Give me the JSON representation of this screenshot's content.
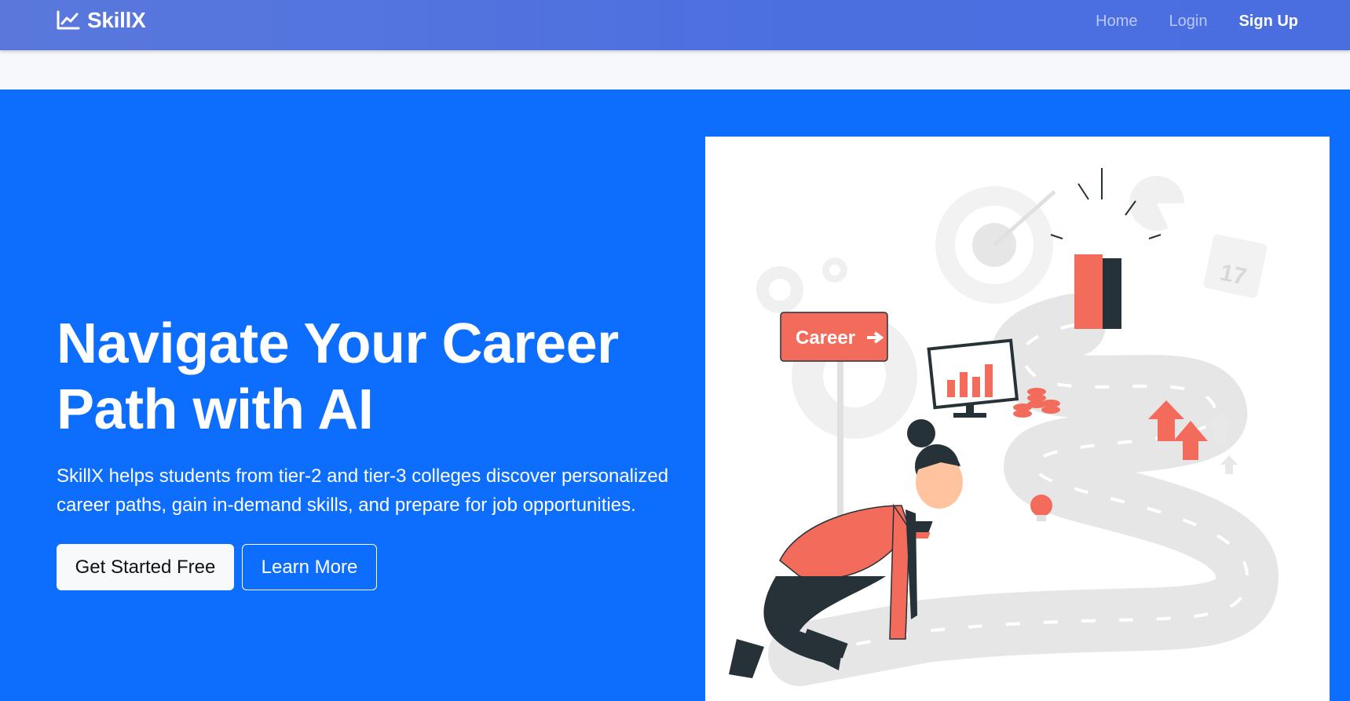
{
  "navbar": {
    "brand": "SkillX",
    "brand_icon": "chart-line-icon",
    "links": [
      {
        "label": "Home",
        "active": false
      },
      {
        "label": "Login",
        "active": false
      },
      {
        "label": "Sign Up",
        "active": true
      }
    ]
  },
  "hero": {
    "title": "Navigate Your Career Path with AI",
    "subtitle": "SkillX helps students from tier-2 and tier-3 colleges discover personalized career paths, gain in-demand skills, and prepare for job opportunities.",
    "primary_button": "Get Started Free",
    "secondary_button": "Learn More",
    "background_color": "#0d6efd"
  },
  "illustration": {
    "sign_text": "Career",
    "calendar_text": "17",
    "accent_color": "#f26b5b",
    "dark_color": "#263238"
  }
}
